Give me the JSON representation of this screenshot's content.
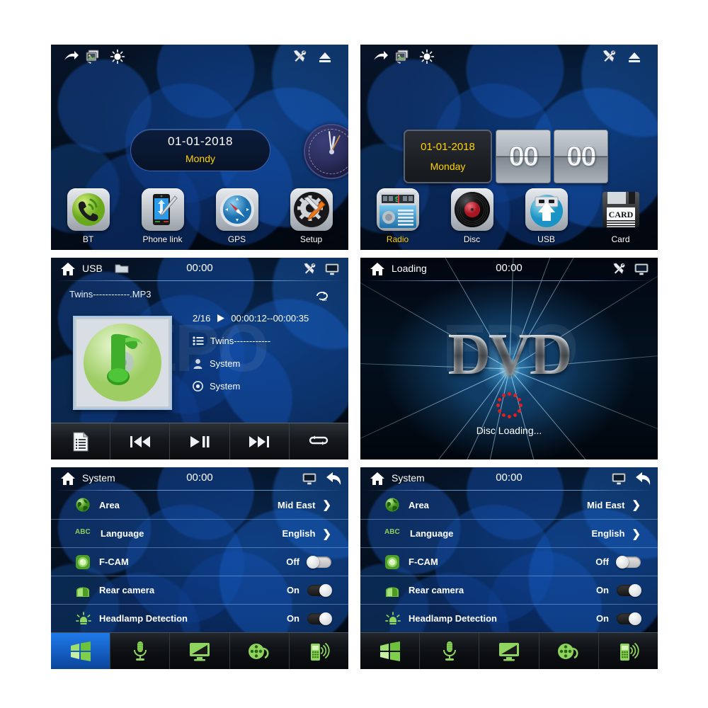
{
  "panels": {
    "home1": {
      "name": "home-screen-media-apps",
      "toolbar": {
        "left": [
          {
            "icon": "share-arrow-icon",
            "name": "share-button"
          },
          {
            "icon": "gallery-icon",
            "name": "gallery-button"
          },
          {
            "icon": "brightness-icon",
            "name": "brightness-button"
          }
        ],
        "right": [
          {
            "icon": "tools-icon",
            "name": "settings-tools-button"
          },
          {
            "icon": "eject-icon",
            "name": "eject-button"
          }
        ]
      },
      "date_widget": {
        "date": "01-01-2018",
        "weekday": "Mondy"
      },
      "analog_clock": {
        "name": "analog-clock-widget"
      },
      "apps": [
        {
          "label": "BT",
          "icon": "bluetooth-phone-icon",
          "highlight": false
        },
        {
          "label": "Phone link",
          "icon": "phone-link-icon",
          "highlight": false
        },
        {
          "label": "GPS",
          "icon": "compass-icon",
          "highlight": false
        },
        {
          "label": "Setup",
          "icon": "gear-wrench-icon",
          "highlight": false
        }
      ]
    },
    "home2": {
      "name": "home-screen-sources",
      "toolbar": {
        "left": [
          {
            "icon": "share-arrow-icon",
            "name": "share-button"
          },
          {
            "icon": "gallery-icon",
            "name": "gallery-button"
          },
          {
            "icon": "brightness-icon",
            "name": "brightness-button"
          }
        ],
        "right": [
          {
            "icon": "tools-icon",
            "name": "settings-tools-button"
          },
          {
            "icon": "eject-icon",
            "name": "eject-button"
          }
        ]
      },
      "date_widget": {
        "date": "01-01-2018",
        "weekday": "Monday"
      },
      "flip_clock": {
        "hours": "00",
        "minutes": "00"
      },
      "apps": [
        {
          "label": "Radio",
          "icon": "radio-icon",
          "highlight": true
        },
        {
          "label": "Disc",
          "icon": "vinyl-disc-icon",
          "highlight": false
        },
        {
          "label": "USB",
          "icon": "usb-icon",
          "highlight": false
        },
        {
          "label": "Card",
          "icon": "sd-card-icon",
          "highlight": false
        }
      ]
    },
    "usb_player": {
      "name": "usb-music-player",
      "header": {
        "home_icon": "home-icon",
        "title": "USB",
        "folder_icon": "folder-icon",
        "clock": "00:00",
        "tools_icon": "tools-icon",
        "display_icon": "monitor-icon"
      },
      "track_filename": "Twins------------.MP3",
      "repeat_icon": "repeat-all-icon",
      "album_art": "music-note-cd-icon",
      "track_index": "2/16",
      "play_state_icon": "play-icon",
      "time_range": "00:00:12--00:00:35",
      "meta": [
        {
          "icon": "track-list-icon",
          "value": "Twins------------"
        },
        {
          "icon": "artist-icon",
          "value": "System"
        },
        {
          "icon": "album-icon",
          "value": "System"
        }
      ],
      "controls": [
        {
          "icon": "playlist-icon",
          "name": "playlist-button"
        },
        {
          "icon": "previous-icon",
          "name": "previous-track-button"
        },
        {
          "icon": "play-pause-icon",
          "name": "play-pause-button"
        },
        {
          "icon": "next-icon",
          "name": "next-track-button"
        },
        {
          "icon": "repeat-icon",
          "name": "repeat-mode-button"
        }
      ]
    },
    "dvd_loading": {
      "name": "dvd-loading-screen",
      "header": {
        "home_icon": "home-icon",
        "title": "Loading",
        "clock": "00:00",
        "tools_icon": "tools-icon",
        "display_icon": "monitor-icon"
      },
      "logo_text": "DVD",
      "status_text": "Disc Loading..."
    },
    "system_a": {
      "name": "system-settings-screen-a",
      "header": {
        "home_icon": "home-icon",
        "title": "System",
        "clock": "00:00",
        "display_icon": "monitor-icon",
        "back_icon": "back-arrow-icon"
      },
      "settings": [
        {
          "icon": "globe-icon",
          "label": "Area",
          "value": "Mid East",
          "control": "chevron"
        },
        {
          "icon": "abc-icon",
          "label": "Language",
          "value": "English",
          "control": "chevron"
        },
        {
          "icon": "front-cam-icon",
          "label": "F-CAM",
          "value": "Off",
          "control": "toggle",
          "state": "off"
        },
        {
          "icon": "rear-cam-icon",
          "label": "Rear camera",
          "value": "On",
          "control": "toggle",
          "state": "on"
        },
        {
          "icon": "headlamp-icon",
          "label": "Headlamp Detection",
          "value": "On",
          "control": "toggle",
          "state": "on"
        }
      ],
      "navbar": [
        {
          "icon": "windows-icon",
          "name": "nav-system",
          "active": true
        },
        {
          "icon": "microphone-icon",
          "name": "nav-voice",
          "active": false
        },
        {
          "icon": "monitor-icon",
          "name": "nav-display",
          "active": false
        },
        {
          "icon": "film-reel-icon",
          "name": "nav-video",
          "active": false
        },
        {
          "icon": "mobile-signal-icon",
          "name": "nav-phone",
          "active": false
        }
      ]
    },
    "system_b": {
      "name": "system-settings-screen-b",
      "header": {
        "home_icon": "home-icon",
        "title": "System",
        "clock": "00:00",
        "display_icon": "monitor-icon",
        "back_icon": "back-arrow-icon"
      },
      "settings": [
        {
          "icon": "globe-icon",
          "label": "Area",
          "value": "Mid East",
          "control": "chevron"
        },
        {
          "icon": "abc-icon",
          "label": "Language",
          "value": "English",
          "control": "chevron"
        },
        {
          "icon": "front-cam-icon",
          "label": "F-CAM",
          "value": "Off",
          "control": "toggle",
          "state": "off"
        },
        {
          "icon": "rear-cam-icon",
          "label": "Rear camera",
          "value": "On",
          "control": "toggle",
          "state": "on"
        },
        {
          "icon": "headlamp-icon",
          "label": "Headlamp Detection",
          "value": "On",
          "control": "toggle",
          "state": "on"
        }
      ],
      "navbar": [
        {
          "icon": "windows-icon",
          "name": "nav-system",
          "active": false
        },
        {
          "icon": "microphone-icon",
          "name": "nav-voice",
          "active": false
        },
        {
          "icon": "monitor-icon",
          "name": "nav-display",
          "active": false
        },
        {
          "icon": "film-reel-icon",
          "name": "nav-video",
          "active": false
        },
        {
          "icon": "mobile-signal-icon",
          "name": "nav-phone",
          "active": false
        }
      ]
    }
  },
  "watermark": "EPO",
  "colors": {
    "accent_yellow": "#ffd200",
    "accent_blue": "#1f79e8",
    "icon_green": "#7ec850",
    "text_white": "#ffffff"
  }
}
